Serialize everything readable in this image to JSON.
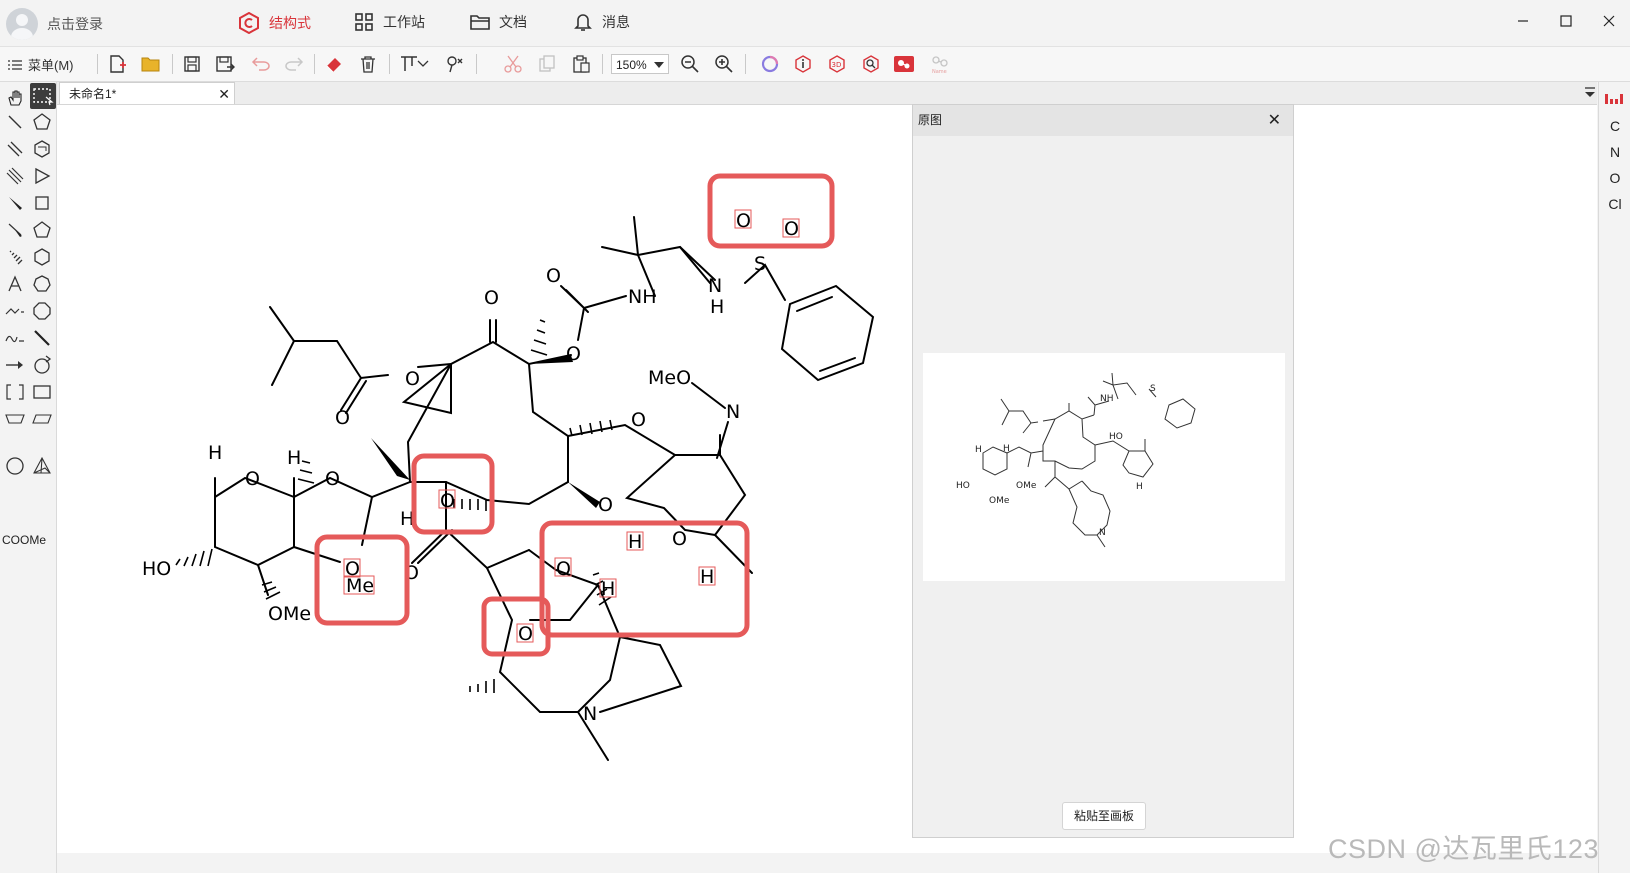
{
  "titlebar": {
    "login": "点击登录",
    "nav": [
      {
        "id": "structure",
        "label": "结构式",
        "active": true
      },
      {
        "id": "workstation",
        "label": "工作站",
        "active": false
      },
      {
        "id": "documents",
        "label": "文档",
        "active": false
      },
      {
        "id": "messages",
        "label": "消息",
        "active": false
      }
    ]
  },
  "toolbar": {
    "menu_label": "菜单(M)",
    "zoom": "150%"
  },
  "palette": {
    "coome_label": "COOMe"
  },
  "tab": {
    "title": "未命名1*"
  },
  "canvas": {
    "labels": {
      "O1": "O",
      "O2": "O",
      "O3": "O",
      "O4": "O",
      "O5": "O",
      "O6": "O",
      "O7": "O",
      "O8": "O",
      "O9": "O",
      "O10": "O",
      "O11": "O",
      "O12": "O",
      "O13": "O",
      "O14": "O",
      "O15": "O",
      "NH1": "NH",
      "N2": "N",
      "H2": "H",
      "S": "S",
      "MeO": "MeO",
      "N_oxime": "N",
      "N_ring": "N",
      "HO": "HO",
      "OMe": "OMe",
      "H1": "H",
      "H3": "H",
      "H4": "H",
      "H5": "H",
      "H6": "H",
      "H7": "H",
      "Me": "Me",
      "O16": "O",
      "O17": "O"
    }
  },
  "panel": {
    "title": "原图",
    "paste_label": "粘贴至画板",
    "thumb_labels": {
      "HO": "HO",
      "OMe1": "OMe",
      "OMe2": "OMe",
      "N": "N",
      "NH": "NH",
      "S": "S",
      "H1": "H",
      "H2": "H",
      "HO2": "HO",
      "H3": "H"
    }
  },
  "rightbar": {
    "elements": [
      "C",
      "N",
      "O",
      "Cl"
    ]
  },
  "watermark": "CSDN @达瓦里氏123",
  "colors": {
    "accent": "#d9343a",
    "highlight": "#e55a5a"
  }
}
